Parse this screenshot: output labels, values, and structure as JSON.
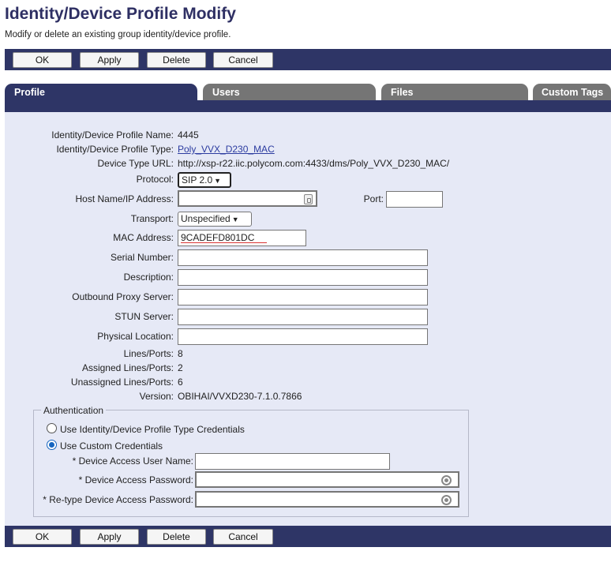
{
  "header": {
    "title": "Identity/Device Profile Modify",
    "subtitle": "Modify or delete an existing group identity/device profile."
  },
  "buttons": {
    "ok": "OK",
    "apply": "Apply",
    "delete": "Delete",
    "cancel": "Cancel"
  },
  "tabs": [
    {
      "label": "Profile",
      "active": true
    },
    {
      "label": "Users",
      "active": false
    },
    {
      "label": "Files",
      "active": false
    },
    {
      "label": "Custom Tags",
      "active": false
    }
  ],
  "profile": {
    "name_label": "Identity/Device Profile Name:",
    "name_value": "4445",
    "type_label": "Identity/Device Profile Type:",
    "type_value": "Poly_VVX_D230_MAC",
    "url_label": "Device Type URL:",
    "url_value": "http://xsp-r22.iic.polycom.com:4433/dms/Poly_VVX_D230_MAC/",
    "protocol_label": "Protocol:",
    "protocol_value": "SIP 2.0",
    "host_label": "Host Name/IP Address:",
    "host_value": "",
    "port_label": "Port:",
    "port_value": "",
    "transport_label": "Transport:",
    "transport_value": "Unspecified",
    "mac_label": "MAC Address:",
    "mac_value": "9CADEFD801DC",
    "serial_label": "Serial Number:",
    "serial_value": "",
    "description_label": "Description:",
    "description_value": "",
    "proxy_label": "Outbound Proxy Server:",
    "proxy_value": "",
    "stun_label": "STUN Server:",
    "stun_value": "",
    "location_label": "Physical Location:",
    "location_value": "",
    "lines_label": "Lines/Ports:",
    "lines_value": "8",
    "assigned_label": "Assigned Lines/Ports:",
    "assigned_value": "2",
    "unassigned_label": "Unassigned Lines/Ports:",
    "unassigned_value": "6",
    "version_label": "Version:",
    "version_value": "OBIHAI/VVXD230-7.1.0.7866"
  },
  "auth": {
    "legend": "Authentication",
    "option_type": "Use Identity/Device Profile Type Credentials",
    "option_custom": "Use Custom Credentials",
    "selected": "custom",
    "username_label": "* Device Access User Name:",
    "username_value": "",
    "password_label": "* Device Access Password:",
    "password_value": "",
    "retype_label": "* Re-type Device Access Password:",
    "retype_value": ""
  },
  "icons": {
    "key": "key-icon",
    "password_reveal": "eye-icon",
    "dropdown": "chevron-down-icon"
  },
  "colors": {
    "title": "#2e2f63",
    "bar": "#2e3566",
    "content_bg": "#e6e9f6",
    "inactive_tab": "#757575",
    "link": "#2c3ca0"
  }
}
